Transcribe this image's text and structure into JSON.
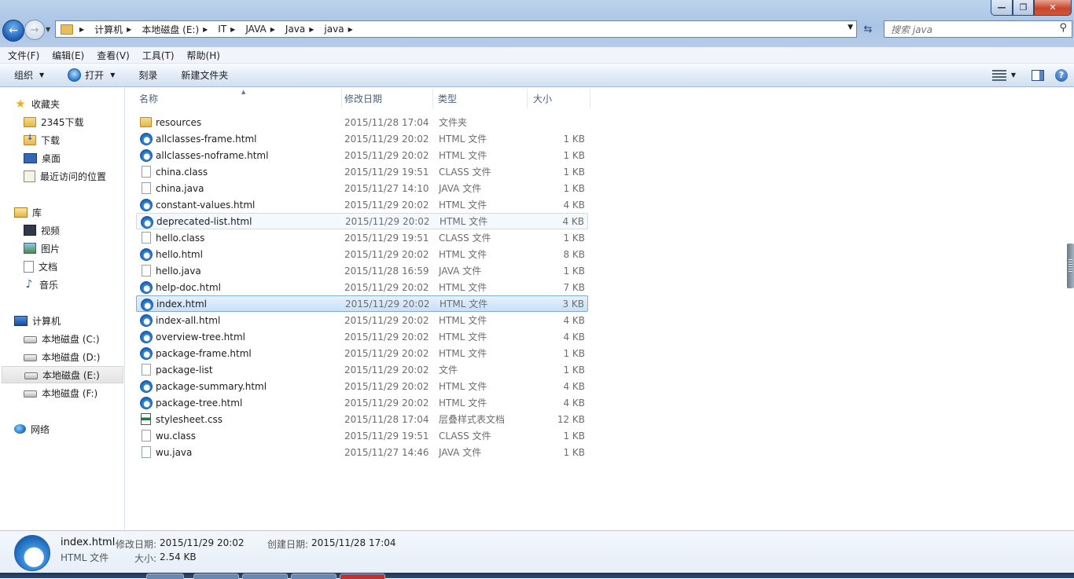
{
  "window": {
    "minimize": "—",
    "maximize": "❐",
    "close": "✕"
  },
  "address": {
    "crumbs": [
      "计算机",
      "本地磁盘 (E:)",
      "IT",
      "JAVA",
      "Java",
      "java"
    ]
  },
  "search": {
    "placeholder": "搜索 java"
  },
  "menu": [
    "文件(F)",
    "编辑(E)",
    "查看(V)",
    "工具(T)",
    "帮助(H)"
  ],
  "toolbar": {
    "organize": "组织",
    "open": "打开",
    "burn": "刻录",
    "new_folder": "新建文件夹"
  },
  "sidebar": {
    "favorites": {
      "label": "收藏夹",
      "items": [
        "2345下载",
        "下载",
        "桌面",
        "最近访问的位置"
      ]
    },
    "libraries": {
      "label": "库",
      "items": [
        "视频",
        "图片",
        "文档",
        "音乐"
      ]
    },
    "computer": {
      "label": "计算机",
      "items": [
        "本地磁盘 (C:)",
        "本地磁盘 (D:)",
        "本地磁盘 (E:)",
        "本地磁盘 (F:)"
      ]
    },
    "network": {
      "label": "网络"
    },
    "selected": "本地磁盘 (E:)"
  },
  "columns": {
    "name": "名称",
    "date": "修改日期",
    "type": "类型",
    "size": "大小"
  },
  "files": [
    {
      "name": "resources",
      "date": "2015/11/28 17:04",
      "type": "文件夹",
      "size": "",
      "icon": "folder-icon"
    },
    {
      "name": "allclasses-frame.html",
      "date": "2015/11/29 20:02",
      "type": "HTML 文件",
      "size": "1 KB",
      "icon": "html-file-icon"
    },
    {
      "name": "allclasses-noframe.html",
      "date": "2015/11/29 20:02",
      "type": "HTML 文件",
      "size": "1 KB",
      "icon": "html-file-icon"
    },
    {
      "name": "china.class",
      "date": "2015/11/29 19:51",
      "type": "CLASS 文件",
      "size": "1 KB",
      "icon": "file-icon"
    },
    {
      "name": "china.java",
      "date": "2015/11/27 14:10",
      "type": "JAVA 文件",
      "size": "1 KB",
      "icon": "file-icon"
    },
    {
      "name": "constant-values.html",
      "date": "2015/11/29 20:02",
      "type": "HTML 文件",
      "size": "4 KB",
      "icon": "html-file-icon"
    },
    {
      "name": "deprecated-list.html",
      "date": "2015/11/29 20:02",
      "type": "HTML 文件",
      "size": "4 KB",
      "icon": "html-file-icon"
    },
    {
      "name": "hello.class",
      "date": "2015/11/29 19:51",
      "type": "CLASS 文件",
      "size": "1 KB",
      "icon": "file-icon"
    },
    {
      "name": "hello.html",
      "date": "2015/11/29 20:02",
      "type": "HTML 文件",
      "size": "8 KB",
      "icon": "html-file-icon"
    },
    {
      "name": "hello.java",
      "date": "2015/11/28 16:59",
      "type": "JAVA 文件",
      "size": "1 KB",
      "icon": "file-icon"
    },
    {
      "name": "help-doc.html",
      "date": "2015/11/29 20:02",
      "type": "HTML 文件",
      "size": "7 KB",
      "icon": "html-file-icon"
    },
    {
      "name": "index.html",
      "date": "2015/11/29 20:02",
      "type": "HTML 文件",
      "size": "3 KB",
      "icon": "html-file-icon"
    },
    {
      "name": "index-all.html",
      "date": "2015/11/29 20:02",
      "type": "HTML 文件",
      "size": "4 KB",
      "icon": "html-file-icon"
    },
    {
      "name": "overview-tree.html",
      "date": "2015/11/29 20:02",
      "type": "HTML 文件",
      "size": "4 KB",
      "icon": "html-file-icon"
    },
    {
      "name": "package-frame.html",
      "date": "2015/11/29 20:02",
      "type": "HTML 文件",
      "size": "1 KB",
      "icon": "html-file-icon"
    },
    {
      "name": "package-list",
      "date": "2015/11/29 20:02",
      "type": "文件",
      "size": "1 KB",
      "icon": "file-icon"
    },
    {
      "name": "package-summary.html",
      "date": "2015/11/29 20:02",
      "type": "HTML 文件",
      "size": "4 KB",
      "icon": "html-file-icon"
    },
    {
      "name": "package-tree.html",
      "date": "2015/11/29 20:02",
      "type": "HTML 文件",
      "size": "4 KB",
      "icon": "html-file-icon"
    },
    {
      "name": "stylesheet.css",
      "date": "2015/11/28 17:04",
      "type": "层叠样式表文档",
      "size": "12 KB",
      "icon": "css-file-icon"
    },
    {
      "name": "wu.class",
      "date": "2015/11/29 19:51",
      "type": "CLASS 文件",
      "size": "1 KB",
      "icon": "file-icon"
    },
    {
      "name": "wu.java",
      "date": "2015/11/27 14:46",
      "type": "JAVA 文件",
      "size": "1 KB",
      "icon": "file-icon"
    }
  ],
  "selected_file": "index.html",
  "hovered_file": "deprecated-list.html",
  "details": {
    "name": "index.html",
    "type": "HTML 文件",
    "modified_label": "修改日期:",
    "modified_value": "2015/11/29 20:02",
    "created_label": "创建日期:",
    "created_value": "2015/11/28 17:04",
    "size_label": "大小:",
    "size_value": "2.54 KB"
  },
  "colors": {
    "selection": "#cce3f8",
    "selection_border": "#84acdd",
    "titlebar": "#b3cbe7",
    "close_button": "#c8452c"
  }
}
